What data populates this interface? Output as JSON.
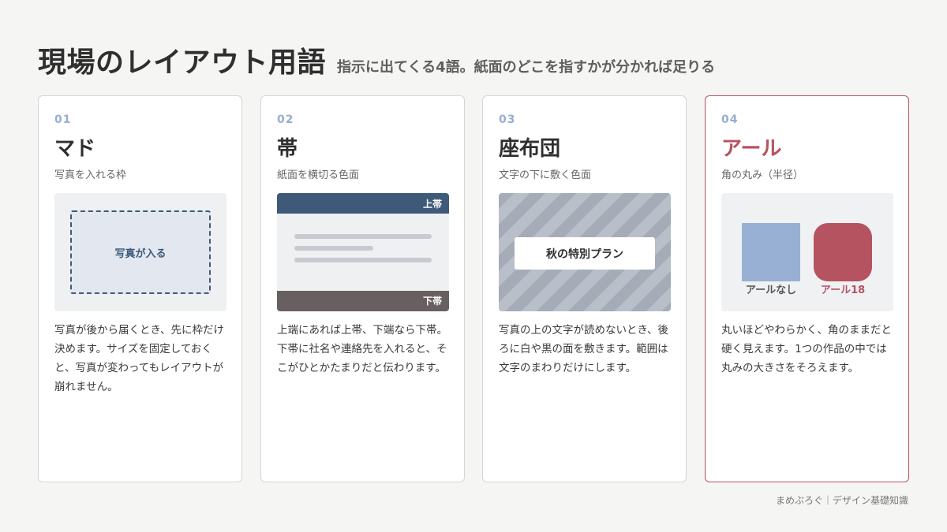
{
  "header": {
    "title": "現場のレイアウト用語",
    "subtitle": "指示に出てくる4語。紙面のどこを指すかが分かれば足りる"
  },
  "cards": [
    {
      "number": "01",
      "term": "マド",
      "gloss": "写真を入れる枠",
      "illustration": {
        "placeholder_label": "写真が入る"
      },
      "description": "写真が後から届くとき、先に枠だけ決めます。サイズを固定しておくと、写真が変わってもレイアウトが崩れません。"
    },
    {
      "number": "02",
      "term": "帯",
      "gloss": "紙面を横切る色面",
      "illustration": {
        "top_band_label": "上帯",
        "bottom_band_label": "下帯"
      },
      "description": "上端にあれば上帯、下端なら下帯。下帯に社名や連絡先を入れると、そこがひとかたまりだと伝わります。"
    },
    {
      "number": "03",
      "term": "座布団",
      "gloss": "文字の下に敷く色面",
      "illustration": {
        "cushion_text": "秋の特別プラン"
      },
      "description": "写真の上の文字が読めないとき、後ろに白や黒の面を敷きます。範囲は文字のまわりだけにします。"
    },
    {
      "number": "04",
      "term": "アール",
      "gloss": "角の丸み（半径）",
      "illustration": {
        "square_label": "アールなし",
        "rounded_label": "アール18"
      },
      "description": "丸いほどやわらかく、角のままだと硬く見えます。1つの作品の中では丸みの大きさをそろえます。"
    }
  ],
  "colors": {
    "navy": "#3e5a78",
    "accent_red": "#b55361",
    "light_blue": "#98b0d3",
    "band_gray": "#686060"
  },
  "footer": {
    "credit": "まめぶろぐ｜デザイン基礎知識"
  }
}
